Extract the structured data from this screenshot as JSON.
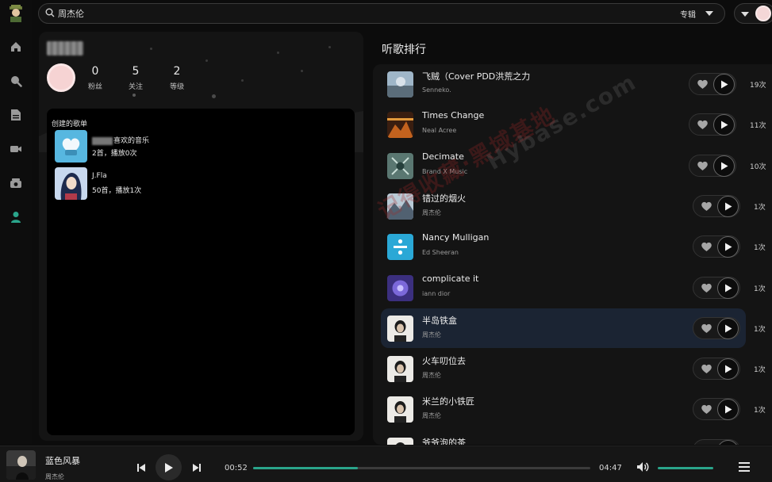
{
  "search": {
    "query": "周杰伦",
    "type_label": "专辑"
  },
  "profile": {
    "stats": [
      {
        "value": "0",
        "label": "粉丝"
      },
      {
        "value": "5",
        "label": "关注"
      },
      {
        "value": "2",
        "label": "等级"
      }
    ],
    "playlists_heading": "创建的歌单",
    "playlists": [
      {
        "name": "喜欢的音乐",
        "meta": "2首，播放0次"
      },
      {
        "name": "J.Fla",
        "meta": "50首，播放1次"
      }
    ]
  },
  "ranking": {
    "title": "听歌排行",
    "songs": [
      {
        "title": "飞贼（Cover PDD洪荒之力",
        "artist": "Senneko.",
        "count": "19次"
      },
      {
        "title": "Times Change",
        "artist": "Neal Acree",
        "count": "11次"
      },
      {
        "title": "Decimate",
        "artist": "Brand X Music",
        "count": "10次"
      },
      {
        "title": "错过的烟火",
        "artist": "周杰伦",
        "count": "1次"
      },
      {
        "title": "Nancy Mulligan",
        "artist": "Ed Sheeran",
        "count": "1次"
      },
      {
        "title": "complicate it",
        "artist": "iann dior",
        "count": "1次"
      },
      {
        "title": "半岛铁盒",
        "artist": "周杰伦",
        "count": "1次"
      },
      {
        "title": "火车叨位去",
        "artist": "周杰伦",
        "count": "1次"
      },
      {
        "title": "米兰的小铁匠",
        "artist": "周杰伦",
        "count": "1次"
      },
      {
        "title": "爷爷泡的茶",
        "artist": "",
        "count": ""
      }
    ]
  },
  "player": {
    "title": "蓝色风暴",
    "artist": "周杰伦",
    "current_time": "00:52",
    "total_time": "04:47",
    "progress": 0.31,
    "volume": 1.0
  },
  "watermark": {
    "line1": "记得收藏·黑域基地",
    "line2": "Hybase.com"
  },
  "colors": {
    "accent": "#2aa58b",
    "active_row": "#1b2433"
  }
}
